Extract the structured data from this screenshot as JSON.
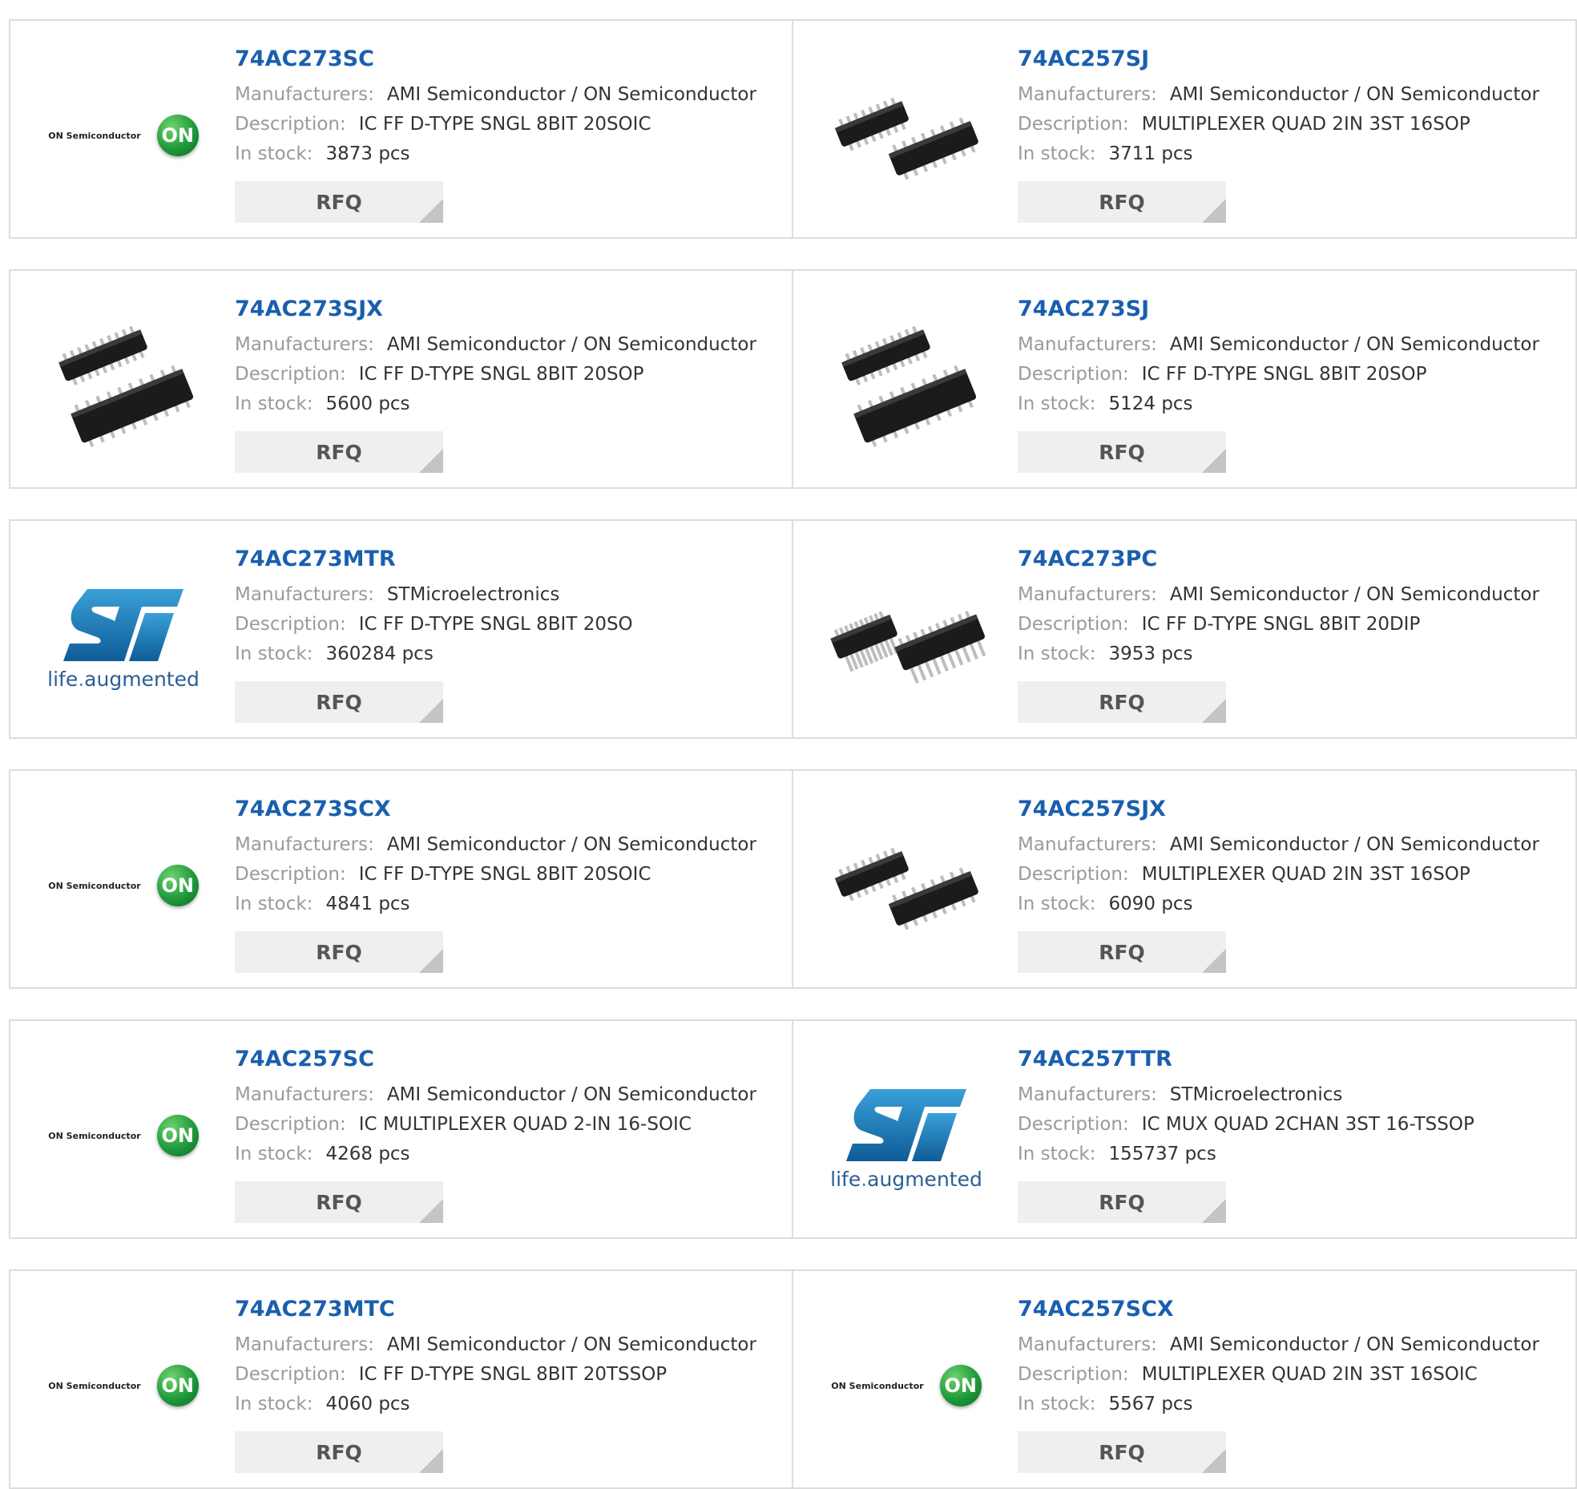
{
  "labels": {
    "manufacturers": "Manufacturers:",
    "description": "Description:",
    "stock": "In stock:",
    "rfq": "RFQ"
  },
  "brand_logos": {
    "on_name": "ON Semiconductor",
    "on_mark": "ON",
    "st_tagline_a": "life",
    "st_tagline_dot": ".",
    "st_tagline_b": "augmented"
  },
  "products": [
    {
      "part": "74AC273SC",
      "manufacturer": "AMI Semiconductor / ON Semiconductor",
      "description": "IC FF D-TYPE SNGL 8BIT 20SOIC",
      "stock": "3873 pcs",
      "image": "on-semiconductor-logo"
    },
    {
      "part": "74AC257SJ",
      "manufacturer": "AMI Semiconductor / ON Semiconductor",
      "description": "MULTIPLEXER QUAD 2IN 3ST 16SOP",
      "stock": "3711 pcs",
      "image": "sop-16-chip"
    },
    {
      "part": "74AC273SJX",
      "manufacturer": "AMI Semiconductor / ON Semiconductor",
      "description": "IC FF D-TYPE SNGL 8BIT 20SOP",
      "stock": "5600 pcs",
      "image": "sop-20-chip"
    },
    {
      "part": "74AC273SJ",
      "manufacturer": "AMI Semiconductor / ON Semiconductor",
      "description": "IC FF D-TYPE SNGL 8BIT 20SOP",
      "stock": "5124 pcs",
      "image": "sop-20-chip"
    },
    {
      "part": "74AC273MTR",
      "manufacturer": "STMicroelectronics",
      "description": "IC FF D-TYPE SNGL 8BIT 20SO",
      "stock": "360284 pcs",
      "image": "st-logo"
    },
    {
      "part": "74AC273PC",
      "manufacturer": "AMI Semiconductor / ON Semiconductor",
      "description": "IC FF D-TYPE SNGL 8BIT 20DIP",
      "stock": "3953 pcs",
      "image": "dip-20-chip"
    },
    {
      "part": "74AC273SCX",
      "manufacturer": "AMI Semiconductor / ON Semiconductor",
      "description": "IC FF D-TYPE SNGL 8BIT 20SOIC",
      "stock": "4841 pcs",
      "image": "on-semiconductor-logo"
    },
    {
      "part": "74AC257SJX",
      "manufacturer": "AMI Semiconductor / ON Semiconductor",
      "description": "MULTIPLEXER QUAD 2IN 3ST 16SOP",
      "stock": "6090 pcs",
      "image": "sop-16-chip"
    },
    {
      "part": "74AC257SC",
      "manufacturer": "AMI Semiconductor / ON Semiconductor",
      "description": "IC MULTIPLEXER QUAD 2-IN 16-SOIC",
      "stock": "4268 pcs",
      "image": "on-semiconductor-logo"
    },
    {
      "part": "74AC257TTR",
      "manufacturer": "STMicroelectronics",
      "description": "IC MUX QUAD 2CHAN 3ST 16-TSSOP",
      "stock": "155737 pcs",
      "image": "st-logo"
    },
    {
      "part": "74AC273MTC",
      "manufacturer": "AMI Semiconductor / ON Semiconductor",
      "description": "IC FF D-TYPE SNGL 8BIT 20TSSOP",
      "stock": "4060 pcs",
      "image": "on-semiconductor-logo"
    },
    {
      "part": "74AC257SCX",
      "manufacturer": "AMI Semiconductor / ON Semiconductor",
      "description": "MULTIPLEXER QUAD 2IN 3ST 16SOIC",
      "stock": "5567 pcs",
      "image": "on-semiconductor-logo"
    }
  ]
}
